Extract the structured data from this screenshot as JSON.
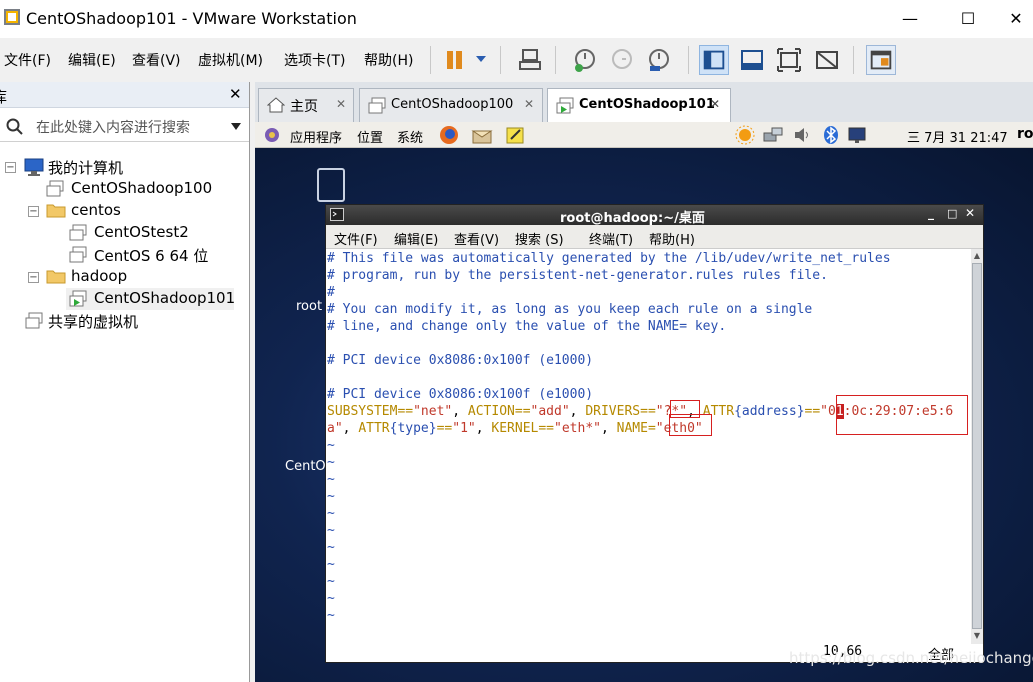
{
  "window": {
    "title": "CentOShadoop101 - VMware Workstation",
    "minimize": "—",
    "maximize": "☐",
    "close": "✕"
  },
  "menu": [
    "文件(F)",
    "编辑(E)",
    "查看(V)",
    "虚拟机(M)",
    "选项卡(T)",
    "帮助(H)"
  ],
  "library": {
    "title": "库",
    "close": "✕",
    "search_placeholder": "在此处键入内容进行搜索",
    "tree": {
      "root": "我的计算机",
      "vm100": "CentOShadoop100",
      "folder_centos": "centos",
      "centostest2": "CentOStest2",
      "centos6": "CentOS 6 64 位",
      "folder_hadoop": "hadoop",
      "vm101": "CentOShadoop101",
      "shared": "共享的虚拟机"
    }
  },
  "tabs": [
    {
      "label": "主页"
    },
    {
      "label": "CentOShadoop100"
    },
    {
      "label": "CentOShadoop101"
    }
  ],
  "guest": {
    "panel": {
      "apps": "应用程序",
      "places": "位置",
      "system": "系统",
      "datetime": "三 7月 31 21:47",
      "user": "ro"
    },
    "desktop": {
      "root_label": "root",
      "centos_label": "CentO"
    },
    "terminal": {
      "title": "root@hadoop:~/桌面",
      "menu": [
        "文件(F)",
        "编辑(E)",
        "查看(V)",
        "搜索 (S)",
        "终端(T)",
        "帮助(H)"
      ],
      "lines": {
        "l1": "# This file was automatically generated by the /lib/udev/write_net_rules",
        "l2": "# program, run by the persistent-net-generator.rules rules file.",
        "l3": "#",
        "l4": "# You can modify it, as long as you keep each rule on a single",
        "l5": "# line, and change only the value of the NAME= key.",
        "l6": "# PCI device 0x8086:0x100f (e1000)",
        "l7": "# PCI device 0x8086:0x100f (e1000)"
      },
      "rule": {
        "subsystem_key": "SUBSYSTEM",
        "subsystem_val": "\"net\"",
        "action_key": "ACTION",
        "action_val": "\"add\"",
        "drivers_key": "DRIVERS",
        "drivers_val": "\"?*\"",
        "attr_key": "ATTR",
        "address_key": "address",
        "mac_part1": "0",
        "mac_cursor": "1",
        "mac_part2": ":0c:29:07:e5:6",
        "mac_wrap": "a",
        "type_key": "type",
        "type_val": "\"1\"",
        "kernel_key": "KERNEL",
        "kernel_val": "\"eth*\"",
        "name_key": "NAME",
        "name_val": "eth0"
      },
      "tilde": "~",
      "status_pos": "10,66",
      "status_all": "全部"
    }
  },
  "watermark": "https://blog.csdn.net/heiiochange"
}
